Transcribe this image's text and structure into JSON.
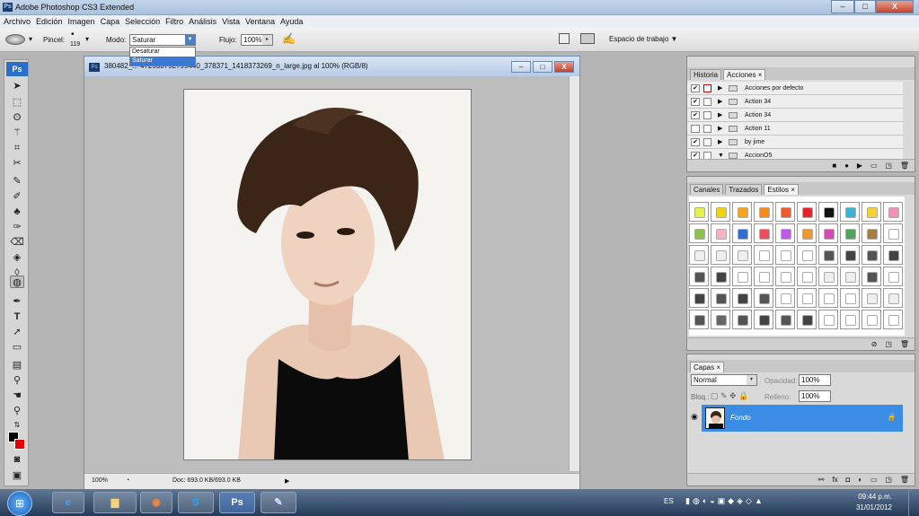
{
  "app": {
    "title": "Adobe Photoshop CS3 Extended",
    "logo": "Ps"
  },
  "window_buttons": {
    "minimize": "–",
    "maximize": "□",
    "close": "X"
  },
  "menu": [
    "Archivo",
    "Edición",
    "Imagen",
    "Capa",
    "Selección",
    "Filtro",
    "Análisis",
    "Vista",
    "Ventana",
    "Ayuda"
  ],
  "options": {
    "brush_label": "Pincel:",
    "brush_size": "119",
    "mode_label": "Modo:",
    "mode_value": "Saturar",
    "mode_options": [
      "Desaturar",
      "Saturar"
    ],
    "flow_label": "Flujo:",
    "flow_value": "100%",
    "workspace": "Espacio de trabajo ▼"
  },
  "document": {
    "title": "380482_... 472930792799440_378371_1418373269_n_large.jpg al 100% (RGB/8)",
    "zoom": "100%",
    "doc_size": "Doc: 693.0 KB/693.0 KB"
  },
  "panels": {
    "history_tab": "Historia",
    "actions_tab": "Acciones ×",
    "actions": [
      {
        "label": "Acciones por defecto",
        "checked": "✔"
      },
      {
        "label": "Action 34",
        "checked": "✔"
      },
      {
        "label": "Action 34",
        "checked": "✔"
      },
      {
        "label": "Action 11",
        "checked": ""
      },
      {
        "label": "by jime",
        "checked": "✔"
      },
      {
        "label": "AccionO5",
        "checked": "✔"
      }
    ],
    "channels_tab": "Canales",
    "paths_tab": "Trazados",
    "styles_tab": "Estilos ×",
    "layers_tab": "Capas ×",
    "blend_mode": "Normal",
    "opacity_label": "Opacidad:",
    "opacity_value": "100%",
    "lock_label": "Bloq.:",
    "fill_label": "Relleno:",
    "fill_value": "100%",
    "layer_name": "Fondo"
  },
  "taskbar": {
    "lang": "ES",
    "time": "09:44 p.m.",
    "date": "31/01/2012",
    "ps_button": "Ps"
  },
  "colors": {
    "accent": "#3a8ce4",
    "foreground": "#000000",
    "background": "#e00000"
  }
}
